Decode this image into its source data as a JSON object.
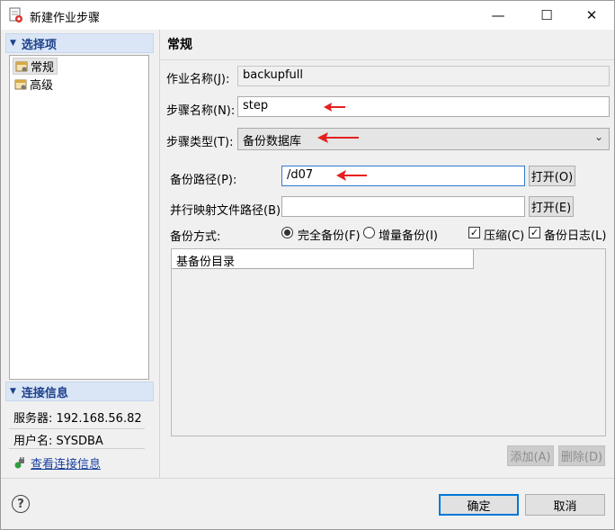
{
  "window": {
    "title": "新建作业步骤",
    "controls": {
      "minimize": "—",
      "maximize": "☐",
      "close": "✕"
    }
  },
  "left": {
    "options_header": "选择项",
    "nav_items": [
      {
        "label": "常规",
        "icon": "settings-page-icon",
        "selected": true
      },
      {
        "label": "高级",
        "icon": "settings-page-icon",
        "selected": false
      }
    ],
    "conn_header": "连接信息",
    "server": "服务器: 192.168.56.82",
    "user": "用户名: SYSDBA",
    "view_conn_link": "查看连接信息"
  },
  "main": {
    "title": "常规",
    "job_name_label": "作业名称(J):",
    "job_name_value": "backupfull",
    "step_name_label": "步骤名称(N):",
    "step_name_value": "step",
    "step_type_label": "步骤类型(T):",
    "step_type_value": "备份数据库",
    "backup_path_label": "备份路径(P):",
    "backup_path_value": "/d07",
    "open_button_1": "打开(O)",
    "parallel_map_label": "并行映射文件路径(B):",
    "parallel_map_value": "",
    "open_button_2": "打开(E)",
    "backup_mode_label": "备份方式:",
    "radio_full": "完全备份(F)",
    "radio_incremental": "增量备份(I)",
    "check_compress": "压缩(C)",
    "check_backup_log": "备份日志(L)",
    "table_column": "基备份目录",
    "add_button": "添加(A)",
    "delete_button": "删除(D)"
  },
  "footer": {
    "help": "?",
    "ok": "确定",
    "cancel": "取消"
  },
  "colors": {
    "accent_blue": "#0078d7",
    "section_header_bg": "#dae6f6",
    "section_header_text": "#1c3f8a",
    "annotation_red": "#e62020"
  }
}
